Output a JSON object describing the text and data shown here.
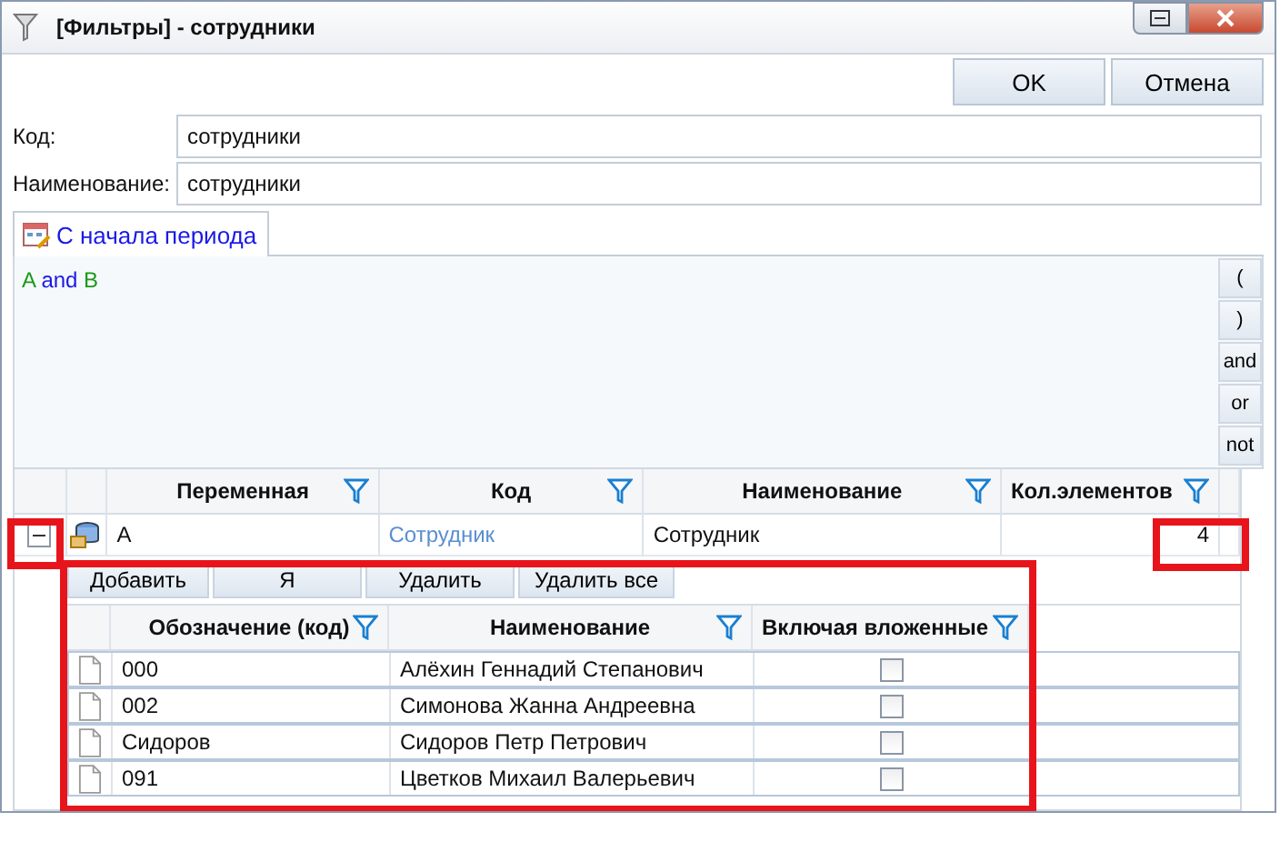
{
  "window": {
    "title": "[Фильтры] - сотрудники"
  },
  "buttons": [
    "OK",
    "Отмена"
  ],
  "fields": [
    {
      "label": "Код:",
      "value": "сотрудники"
    },
    {
      "label": "Наименование:",
      "value": "сотрудники"
    }
  ],
  "tabs": [
    {
      "label": "С начала периода",
      "selected": true
    }
  ],
  "expression": [
    {
      "text": "A",
      "kind": "variable"
    },
    {
      "text": "and",
      "kind": "operator"
    },
    {
      "text": "B",
      "kind": "variable"
    }
  ],
  "operator_buttons": [
    "(",
    ")",
    "and",
    "or",
    "not"
  ],
  "variables": {
    "columns": [
      "Переменная",
      "Код",
      "Наименование",
      "Кол.элементов"
    ],
    "rows": [
      {
        "expanded": true,
        "variable": "A",
        "code": "Сотрудник",
        "name": "Сотрудник",
        "count": "4"
      }
    ]
  },
  "element_toolbar": [
    "Добавить",
    "Я",
    "Удалить",
    "Удалить все"
  ],
  "elements": {
    "columns": [
      "Обозначение (код)",
      "Наименование",
      "Включая вложенные"
    ],
    "rows": [
      {
        "code": "000",
        "name": "Алёхин Геннадий Степанович",
        "include_nested": false
      },
      {
        "code": "002",
        "name": "Симонова Жанна Андреевна",
        "include_nested": false
      },
      {
        "code": "Сидоров",
        "name": "Сидоров Петр Петрович",
        "include_nested": false
      },
      {
        "code": "091",
        "name": "Цветков Михаил Валерьевич",
        "include_nested": false
      }
    ]
  }
}
